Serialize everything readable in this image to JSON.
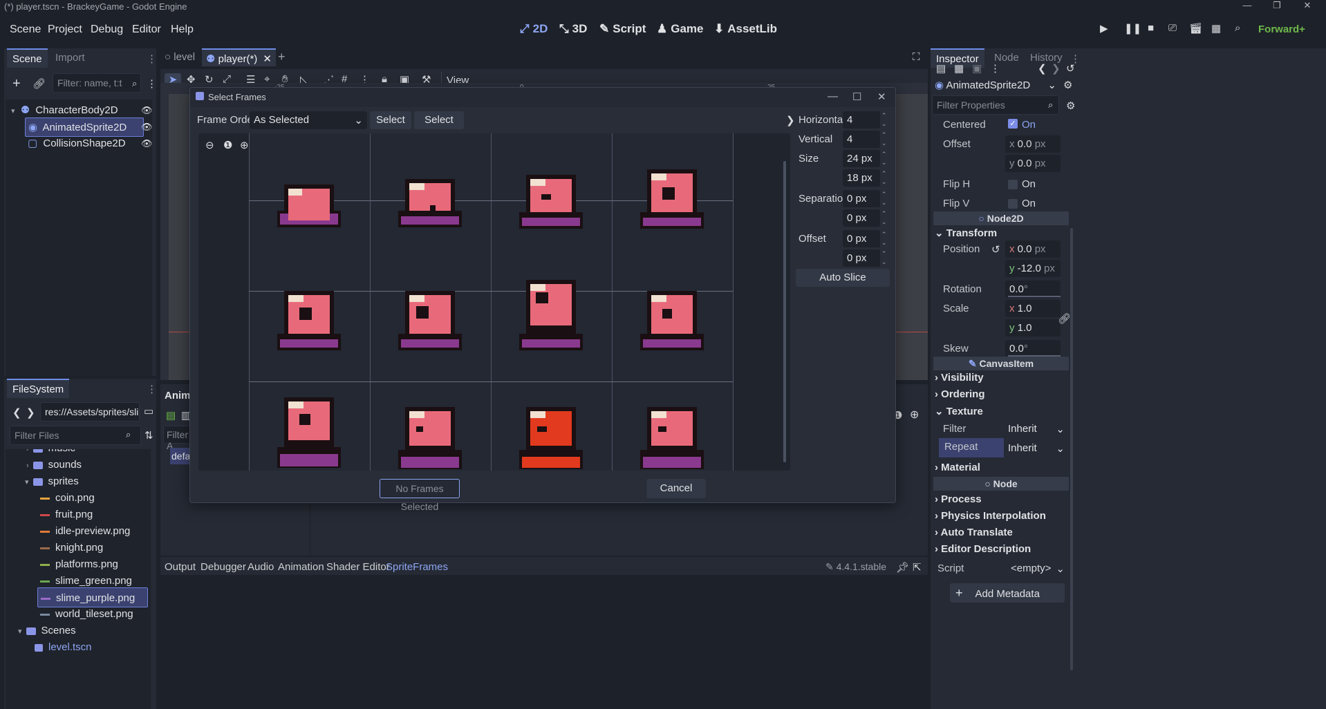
{
  "window": {
    "title": "(*) player.tscn - BrackeyGame - Godot Engine"
  },
  "menu": [
    "Scene",
    "Project",
    "Debug",
    "Editor",
    "Help"
  ],
  "workspaces": [
    {
      "label": "2D",
      "icon": "2d-icon"
    },
    {
      "label": "3D",
      "icon": "3d-icon"
    },
    {
      "label": "Script",
      "icon": "script-icon"
    },
    {
      "label": "Game",
      "icon": "game-icon"
    },
    {
      "label": "AssetLib",
      "icon": "assetlib-icon"
    }
  ],
  "renderer": "Forward+",
  "scene_dock": {
    "tabs": [
      "Scene",
      "Import"
    ],
    "filter_placeholder": "Filter: name, t:t",
    "nodes": [
      {
        "label": "CharacterBody2D"
      },
      {
        "label": "AnimatedSprite2D"
      },
      {
        "label": "CollisionShape2D"
      }
    ]
  },
  "filesystem": {
    "tab": "FileSystem",
    "path": "res://Assets/sprites/slime_",
    "filter_placeholder": "Filter Files",
    "items": [
      {
        "label": "music",
        "type": "folder"
      },
      {
        "label": "sounds",
        "type": "folder"
      },
      {
        "label": "sprites",
        "type": "folder"
      },
      {
        "label": "coin.png",
        "type": "file",
        "color": "#e6a23a"
      },
      {
        "label": "fruit.png",
        "type": "file",
        "color": "#d04848"
      },
      {
        "label": "idle-preview.png",
        "type": "file",
        "color": "#e07b3a"
      },
      {
        "label": "knight.png",
        "type": "file",
        "color": "#9a6a4a"
      },
      {
        "label": "platforms.png",
        "type": "file",
        "color": "#8fb04a"
      },
      {
        "label": "slime_green.png",
        "type": "file",
        "color": "#6aa84f"
      },
      {
        "label": "slime_purple.png",
        "type": "file",
        "color": "#9b6bc8"
      },
      {
        "label": "world_tileset.png",
        "type": "file",
        "color": "#7a8aa0"
      },
      {
        "label": "Scenes",
        "type": "folder"
      },
      {
        "label": "level.tscn",
        "type": "scene"
      }
    ]
  },
  "scene_tabs": [
    {
      "label": "level"
    },
    {
      "label": "player(*)"
    }
  ],
  "viewport_toolbar": {
    "view_label": "View"
  },
  "ruler": {
    "ticks": [
      "-25",
      "0",
      "25"
    ]
  },
  "animation_panel": {
    "title": "Anima",
    "filter": "Filter A",
    "anim": "defa"
  },
  "dialog": {
    "title": "Select Frames",
    "frame_order_label": "Frame Order",
    "frame_order_value": "As Selected",
    "select_all": "Select All",
    "select_none": "Select None",
    "fields": [
      {
        "label": "Horizontal",
        "values": [
          "4"
        ]
      },
      {
        "label": "Vertical",
        "values": [
          "4"
        ]
      },
      {
        "label": "Size",
        "values": [
          "24 px",
          "18 px"
        ]
      },
      {
        "label": "Separation",
        "values": [
          "0 px",
          "0 px"
        ]
      },
      {
        "label": "Offset",
        "values": [
          "0 px",
          "0 px"
        ]
      }
    ],
    "auto_slice": "Auto Slice",
    "confirm": "No Frames Selected",
    "cancel": "Cancel"
  },
  "inspector": {
    "tabs": [
      "Inspector",
      "Node",
      "History"
    ],
    "node_type": "AnimatedSprite2D",
    "filter_placeholder": "Filter Properties",
    "centered": {
      "label": "Centered",
      "value": "On"
    },
    "offset": {
      "label": "Offset",
      "x": "0.0",
      "y": "0.0",
      "unit": "px"
    },
    "flip_h": {
      "label": "Flip H",
      "value": "On"
    },
    "flip_v": {
      "label": "Flip V",
      "value": "On"
    },
    "cat_node2d": "Node2D",
    "transform": "Transform",
    "position": {
      "label": "Position",
      "x": "0.0",
      "y": "-12.0",
      "unit": "px"
    },
    "rotation": {
      "label": "Rotation",
      "value": "0.0",
      "unit": "°"
    },
    "scale": {
      "label": "Scale",
      "x": "1.0",
      "y": "1.0"
    },
    "skew": {
      "label": "Skew",
      "value": "0.0",
      "unit": "°"
    },
    "cat_canvasitem": "CanvasItem",
    "visibility": "Visibility",
    "ordering": "Ordering",
    "texture": "Texture",
    "filter": {
      "label": "Filter",
      "value": "Inherit"
    },
    "repeat": {
      "label": "Repeat",
      "value": "Inherit"
    },
    "material": "Material",
    "cat_node": "Node",
    "process": "Process",
    "physics_interp": "Physics Interpolation",
    "auto_translate": "Auto Translate",
    "editor_desc": "Editor Description",
    "script": {
      "label": "Script",
      "value": "<empty>"
    },
    "add_metadata": "Add Metadata"
  },
  "bottom_tabs": [
    "Output",
    "Debugger",
    "Audio",
    "Animation",
    "Shader Editor",
    "SpriteFrames"
  ],
  "version": "4.4.1.stable",
  "axis_letters": {
    "x": "x",
    "y": "y"
  }
}
